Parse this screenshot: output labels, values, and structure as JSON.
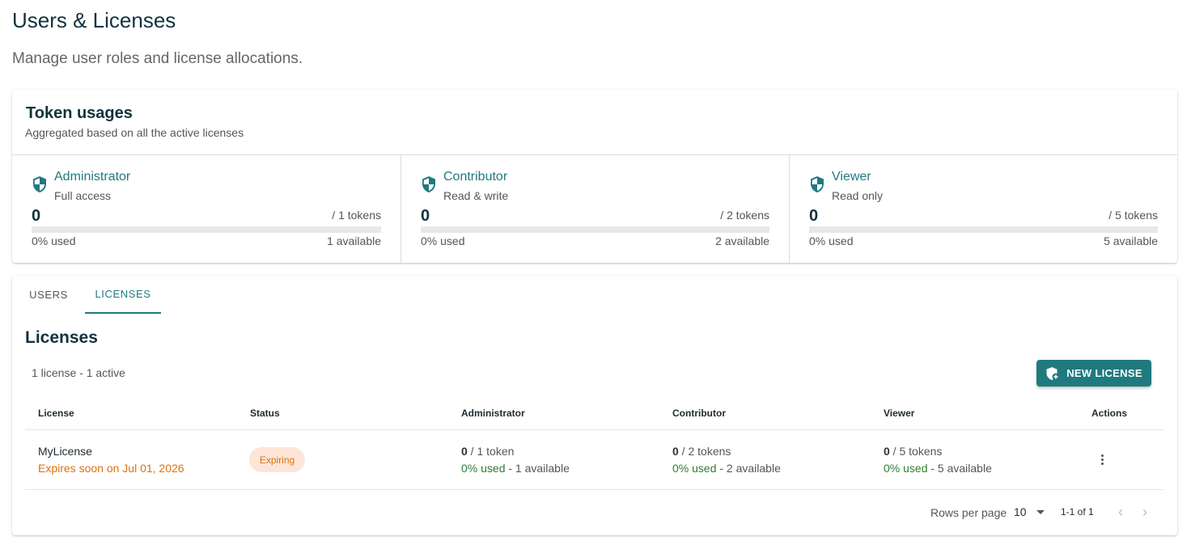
{
  "page": {
    "title": "Users & Licenses",
    "subtitle": "Manage user roles and license allocations."
  },
  "token_usages": {
    "title": "Token usages",
    "subtitle": "Aggregated based on all the active licenses",
    "roles": [
      {
        "name": "Administrator",
        "desc": "Full access",
        "used": "0",
        "total": "/ 1 tokens",
        "percent": "0% used",
        "available": "1 available",
        "fraction_used": 0
      },
      {
        "name": "Contributor",
        "desc": "Read & write",
        "used": "0",
        "total": "/ 2 tokens",
        "percent": "0% used",
        "available": "2 available",
        "fraction_used": 0
      },
      {
        "name": "Viewer",
        "desc": "Read only",
        "used": "0",
        "total": "/ 5 tokens",
        "percent": "0% used",
        "available": "5 available",
        "fraction_used": 0
      }
    ]
  },
  "tabs": [
    {
      "label": "USERS",
      "active": false
    },
    {
      "label": "LICENSES",
      "active": true
    }
  ],
  "licenses": {
    "title": "Licenses",
    "summary": "1 license - 1 active",
    "new_button": "NEW LICENSE",
    "columns": [
      "License",
      "Status",
      "Administrator",
      "Contributor",
      "Viewer",
      "Actions"
    ],
    "rows": [
      {
        "name": "MyLicense",
        "expiry": "Expires soon on Jul 01, 2026",
        "status": "Expiring",
        "administrator": {
          "used": "0",
          "total": " / 1 token",
          "percent": "0% used",
          "available": " - 1 available"
        },
        "contributor": {
          "used": "0",
          "total": " / 2 tokens",
          "percent": "0% used",
          "available": " - 2 available"
        },
        "viewer": {
          "used": "0",
          "total": " / 5 tokens",
          "percent": "0% used",
          "available": " - 5 available"
        }
      }
    ]
  },
  "pagination": {
    "rows_per_page_label": "Rows per page",
    "rows_per_page": "10",
    "range": "1-1 of 1"
  },
  "colors": {
    "accent": "#1f7a80",
    "warning": "#d9730d",
    "warning_bg": "#fde6d8",
    "success": "#2e7d32"
  },
  "icons": {
    "role": "shield-icon",
    "new_license": "shield-plus-icon",
    "actions": "more-vertical-icon",
    "rows_dropdown": "caret-down-icon",
    "prev_page": "chevron-left-icon",
    "next_page": "chevron-right-icon"
  }
}
